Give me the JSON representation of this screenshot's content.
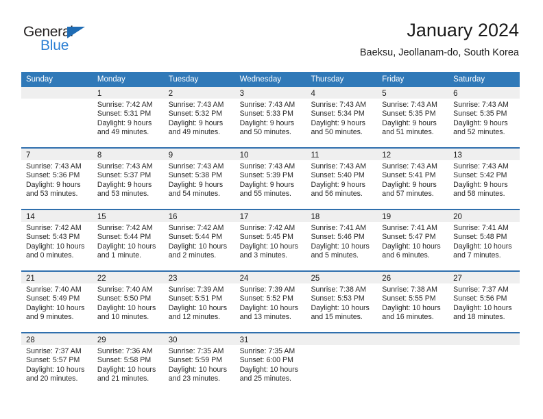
{
  "brand": {
    "name_part1": "General",
    "name_part2": "Blue"
  },
  "header": {
    "title": "January 2024",
    "subtitle": "Baeksu, Jeollanam-do, South Korea"
  },
  "colors": {
    "header_blue": "#3079b8",
    "row_rule_blue": "#2f6fad",
    "daynum_band": "#efefef",
    "logo_blue": "#2b7fd4"
  },
  "weekday_headers": [
    "Sunday",
    "Monday",
    "Tuesday",
    "Wednesday",
    "Thursday",
    "Friday",
    "Saturday"
  ],
  "weeks": [
    [
      {
        "day": ""
      },
      {
        "day": "1",
        "sunrise": "Sunrise: 7:42 AM",
        "sunset": "Sunset: 5:31 PM",
        "daylight_line1": "Daylight: 9 hours",
        "daylight_line2": "and 49 minutes."
      },
      {
        "day": "2",
        "sunrise": "Sunrise: 7:43 AM",
        "sunset": "Sunset: 5:32 PM",
        "daylight_line1": "Daylight: 9 hours",
        "daylight_line2": "and 49 minutes."
      },
      {
        "day": "3",
        "sunrise": "Sunrise: 7:43 AM",
        "sunset": "Sunset: 5:33 PM",
        "daylight_line1": "Daylight: 9 hours",
        "daylight_line2": "and 50 minutes."
      },
      {
        "day": "4",
        "sunrise": "Sunrise: 7:43 AM",
        "sunset": "Sunset: 5:34 PM",
        "daylight_line1": "Daylight: 9 hours",
        "daylight_line2": "and 50 minutes."
      },
      {
        "day": "5",
        "sunrise": "Sunrise: 7:43 AM",
        "sunset": "Sunset: 5:35 PM",
        "daylight_line1": "Daylight: 9 hours",
        "daylight_line2": "and 51 minutes."
      },
      {
        "day": "6",
        "sunrise": "Sunrise: 7:43 AM",
        "sunset": "Sunset: 5:35 PM",
        "daylight_line1": "Daylight: 9 hours",
        "daylight_line2": "and 52 minutes."
      }
    ],
    [
      {
        "day": "7",
        "sunrise": "Sunrise: 7:43 AM",
        "sunset": "Sunset: 5:36 PM",
        "daylight_line1": "Daylight: 9 hours",
        "daylight_line2": "and 53 minutes."
      },
      {
        "day": "8",
        "sunrise": "Sunrise: 7:43 AM",
        "sunset": "Sunset: 5:37 PM",
        "daylight_line1": "Daylight: 9 hours",
        "daylight_line2": "and 53 minutes."
      },
      {
        "day": "9",
        "sunrise": "Sunrise: 7:43 AM",
        "sunset": "Sunset: 5:38 PM",
        "daylight_line1": "Daylight: 9 hours",
        "daylight_line2": "and 54 minutes."
      },
      {
        "day": "10",
        "sunrise": "Sunrise: 7:43 AM",
        "sunset": "Sunset: 5:39 PM",
        "daylight_line1": "Daylight: 9 hours",
        "daylight_line2": "and 55 minutes."
      },
      {
        "day": "11",
        "sunrise": "Sunrise: 7:43 AM",
        "sunset": "Sunset: 5:40 PM",
        "daylight_line1": "Daylight: 9 hours",
        "daylight_line2": "and 56 minutes."
      },
      {
        "day": "12",
        "sunrise": "Sunrise: 7:43 AM",
        "sunset": "Sunset: 5:41 PM",
        "daylight_line1": "Daylight: 9 hours",
        "daylight_line2": "and 57 minutes."
      },
      {
        "day": "13",
        "sunrise": "Sunrise: 7:43 AM",
        "sunset": "Sunset: 5:42 PM",
        "daylight_line1": "Daylight: 9 hours",
        "daylight_line2": "and 58 minutes."
      }
    ],
    [
      {
        "day": "14",
        "sunrise": "Sunrise: 7:42 AM",
        "sunset": "Sunset: 5:43 PM",
        "daylight_line1": "Daylight: 10 hours",
        "daylight_line2": "and 0 minutes."
      },
      {
        "day": "15",
        "sunrise": "Sunrise: 7:42 AM",
        "sunset": "Sunset: 5:44 PM",
        "daylight_line1": "Daylight: 10 hours",
        "daylight_line2": "and 1 minute."
      },
      {
        "day": "16",
        "sunrise": "Sunrise: 7:42 AM",
        "sunset": "Sunset: 5:44 PM",
        "daylight_line1": "Daylight: 10 hours",
        "daylight_line2": "and 2 minutes."
      },
      {
        "day": "17",
        "sunrise": "Sunrise: 7:42 AM",
        "sunset": "Sunset: 5:45 PM",
        "daylight_line1": "Daylight: 10 hours",
        "daylight_line2": "and 3 minutes."
      },
      {
        "day": "18",
        "sunrise": "Sunrise: 7:41 AM",
        "sunset": "Sunset: 5:46 PM",
        "daylight_line1": "Daylight: 10 hours",
        "daylight_line2": "and 5 minutes."
      },
      {
        "day": "19",
        "sunrise": "Sunrise: 7:41 AM",
        "sunset": "Sunset: 5:47 PM",
        "daylight_line1": "Daylight: 10 hours",
        "daylight_line2": "and 6 minutes."
      },
      {
        "day": "20",
        "sunrise": "Sunrise: 7:41 AM",
        "sunset": "Sunset: 5:48 PM",
        "daylight_line1": "Daylight: 10 hours",
        "daylight_line2": "and 7 minutes."
      }
    ],
    [
      {
        "day": "21",
        "sunrise": "Sunrise: 7:40 AM",
        "sunset": "Sunset: 5:49 PM",
        "daylight_line1": "Daylight: 10 hours",
        "daylight_line2": "and 9 minutes."
      },
      {
        "day": "22",
        "sunrise": "Sunrise: 7:40 AM",
        "sunset": "Sunset: 5:50 PM",
        "daylight_line1": "Daylight: 10 hours",
        "daylight_line2": "and 10 minutes."
      },
      {
        "day": "23",
        "sunrise": "Sunrise: 7:39 AM",
        "sunset": "Sunset: 5:51 PM",
        "daylight_line1": "Daylight: 10 hours",
        "daylight_line2": "and 12 minutes."
      },
      {
        "day": "24",
        "sunrise": "Sunrise: 7:39 AM",
        "sunset": "Sunset: 5:52 PM",
        "daylight_line1": "Daylight: 10 hours",
        "daylight_line2": "and 13 minutes."
      },
      {
        "day": "25",
        "sunrise": "Sunrise: 7:38 AM",
        "sunset": "Sunset: 5:53 PM",
        "daylight_line1": "Daylight: 10 hours",
        "daylight_line2": "and 15 minutes."
      },
      {
        "day": "26",
        "sunrise": "Sunrise: 7:38 AM",
        "sunset": "Sunset: 5:55 PM",
        "daylight_line1": "Daylight: 10 hours",
        "daylight_line2": "and 16 minutes."
      },
      {
        "day": "27",
        "sunrise": "Sunrise: 7:37 AM",
        "sunset": "Sunset: 5:56 PM",
        "daylight_line1": "Daylight: 10 hours",
        "daylight_line2": "and 18 minutes."
      }
    ],
    [
      {
        "day": "28",
        "sunrise": "Sunrise: 7:37 AM",
        "sunset": "Sunset: 5:57 PM",
        "daylight_line1": "Daylight: 10 hours",
        "daylight_line2": "and 20 minutes."
      },
      {
        "day": "29",
        "sunrise": "Sunrise: 7:36 AM",
        "sunset": "Sunset: 5:58 PM",
        "daylight_line1": "Daylight: 10 hours",
        "daylight_line2": "and 21 minutes."
      },
      {
        "day": "30",
        "sunrise": "Sunrise: 7:35 AM",
        "sunset": "Sunset: 5:59 PM",
        "daylight_line1": "Daylight: 10 hours",
        "daylight_line2": "and 23 minutes."
      },
      {
        "day": "31",
        "sunrise": "Sunrise: 7:35 AM",
        "sunset": "Sunset: 6:00 PM",
        "daylight_line1": "Daylight: 10 hours",
        "daylight_line2": "and 25 minutes."
      },
      {
        "day": ""
      },
      {
        "day": ""
      },
      {
        "day": ""
      }
    ]
  ]
}
